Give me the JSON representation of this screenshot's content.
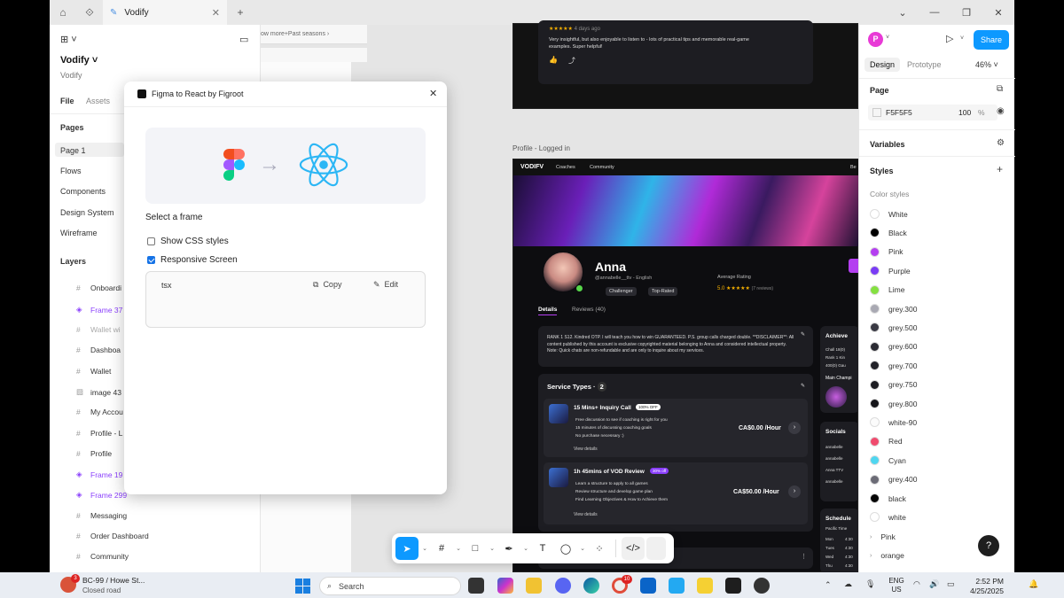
{
  "app": {
    "tab_title": "Vodify"
  },
  "left_panel": {
    "file_name": "Vodify",
    "team": "Vodify",
    "tabs": [
      "File",
      "Assets"
    ],
    "pages_heading": "Pages",
    "pages": [
      "Page 1",
      "Flows",
      "Components",
      "Design System",
      "Wireframe"
    ],
    "layers_heading": "Layers",
    "layers": [
      {
        "label": "Onboardi",
        "kind": "frame"
      },
      {
        "label": "Frame 37",
        "kind": "component"
      },
      {
        "label": "Wallet wi",
        "kind": "hidden"
      },
      {
        "label": "Dashboa",
        "kind": "frame"
      },
      {
        "label": "Wallet",
        "kind": "frame"
      },
      {
        "label": "image 43",
        "kind": "image"
      },
      {
        "label": "My Accou",
        "kind": "frame"
      },
      {
        "label": "Profile - L",
        "kind": "frame"
      },
      {
        "label": "Profile",
        "kind": "frame"
      },
      {
        "label": "Frame 19",
        "kind": "component"
      },
      {
        "label": "Frame 299",
        "kind": "component"
      },
      {
        "label": "Messaging",
        "kind": "frame"
      },
      {
        "label": "Order Dashboard",
        "kind": "frame"
      },
      {
        "label": "Community",
        "kind": "frame"
      }
    ]
  },
  "modal": {
    "title": "Figma to React by Figroot",
    "select_frame_label": "Select a frame",
    "options": [
      {
        "label": "Show CSS styles",
        "checked": false
      },
      {
        "label": "Responsive Screen",
        "checked": true
      }
    ],
    "code_lang": "tsx",
    "copy_label": "Copy",
    "edit_label": "Edit"
  },
  "canvas": {
    "top_card_review": "Very insightful, but also enjoyable to listen to - lots of practical tips and memorable real-game examples. Super helpful!",
    "top_card_time": "4 days ago",
    "partial_header": "ow more+Past seasons",
    "frame_label": "Profile - Logged in",
    "profile": {
      "brand": "VODIFV",
      "nav": [
        "Coaches",
        "Community"
      ],
      "nav_right": "Be",
      "name": "Anna",
      "handle": "@annabelle__ttv - English",
      "badges": [
        "Challenger",
        "Top-Rated"
      ],
      "rating_label": "Average Rating",
      "rating_value": "5.0 ★★★★★",
      "rating_count": "(7 reviews)",
      "tabs": [
        "Details",
        "Reviews (40)"
      ],
      "bio": "RANK 1 S12. Kindred OTP. I will teach you how to win GUARANTEED. P.S. group calls charged double. **DISCLAIMER**: All content published by this account is exclusive copyrighted material belonging to Anna and considered intellectual property. Note: Quick chats are non-refundable and are only to inquire about my services.",
      "service_types_label": "Service Types",
      "service_count": "2",
      "services": [
        {
          "title": "15 Mins+ Inquiry Call",
          "tag": "100% OFF",
          "bullets": [
            "Free discussion to see if coaching is right for you",
            "15 minutes of discussing coaching goals",
            "No purchase necessary :)"
          ],
          "price": "CA$0.00 /Hour",
          "details": "View details"
        },
        {
          "title": "1h 45mins of VOD Review",
          "tag": "30% off",
          "bullets": [
            "Learn a structure to apply to all games",
            "Review structure and develop game plan",
            "Find Learning Objectives & How to Achieve them"
          ],
          "price": "CA$50.00 /Hour",
          "details": "View details"
        }
      ],
      "side": {
        "achievements": "Achieve",
        "achievement_items": [
          "Chall 18(0)",
          "Rank 1 Kin",
          "400(0) Gau"
        ],
        "main_champ": "Main Champi",
        "socials": "Socials",
        "social_items": [
          "annabelle",
          "annabelle",
          "Anna TTV",
          "annabelle"
        ],
        "schedule": "Schedule",
        "timezone": "Pacific Time",
        "days": [
          "Mon",
          "Tues",
          "Wed",
          "Thu"
        ],
        "times": [
          "4:30",
          "4:30",
          "4:30",
          "4:30"
        ]
      }
    }
  },
  "right_panel": {
    "avatar_letter": "P",
    "share_label": "Share",
    "tabs": [
      "Design",
      "Prototype"
    ],
    "zoom": "46%",
    "page_heading": "Page",
    "page_color": "F5F5F5",
    "page_opacity": "100",
    "page_opacity_unit": "%",
    "variables_heading": "Variables",
    "styles_heading": "Styles",
    "color_styles_label": "Color styles",
    "colors": [
      {
        "name": "White",
        "hex": "#ffffff"
      },
      {
        "name": "Black",
        "hex": "#000000"
      },
      {
        "name": "Pink",
        "hex": "#b43ff0"
      },
      {
        "name": "Purple",
        "hex": "#7a3cf5"
      },
      {
        "name": "Lime",
        "hex": "#84e040"
      },
      {
        "name": "grey.300",
        "hex": "#a9a9b3"
      },
      {
        "name": "grey.500",
        "hex": "#3a3a44"
      },
      {
        "name": "grey.600",
        "hex": "#2b2b33"
      },
      {
        "name": "grey.700",
        "hex": "#222228"
      },
      {
        "name": "grey.750",
        "hex": "#1c1c21"
      },
      {
        "name": "grey.800",
        "hex": "#151519"
      },
      {
        "name": "white-90",
        "hex": "#fbfbfb"
      },
      {
        "name": "Red",
        "hex": "#f04b6e"
      },
      {
        "name": "Cyan",
        "hex": "#4fd6f0"
      },
      {
        "name": "grey.400",
        "hex": "#6b6b76"
      },
      {
        "name": "black",
        "hex": "#050505"
      },
      {
        "name": "white",
        "hex": "#ffffff"
      }
    ],
    "collapsed_groups": [
      "Pink",
      "orange"
    ],
    "help": "?"
  },
  "taskbar": {
    "weather_title": "BC-99 / Howe St...",
    "weather_sub": "Closed road",
    "weather_badge": "3",
    "search_placeholder": "Search",
    "lang": "ENG",
    "region": "US",
    "time": "2:52 PM",
    "date": "4/25/2025",
    "notif_badge": "10"
  }
}
